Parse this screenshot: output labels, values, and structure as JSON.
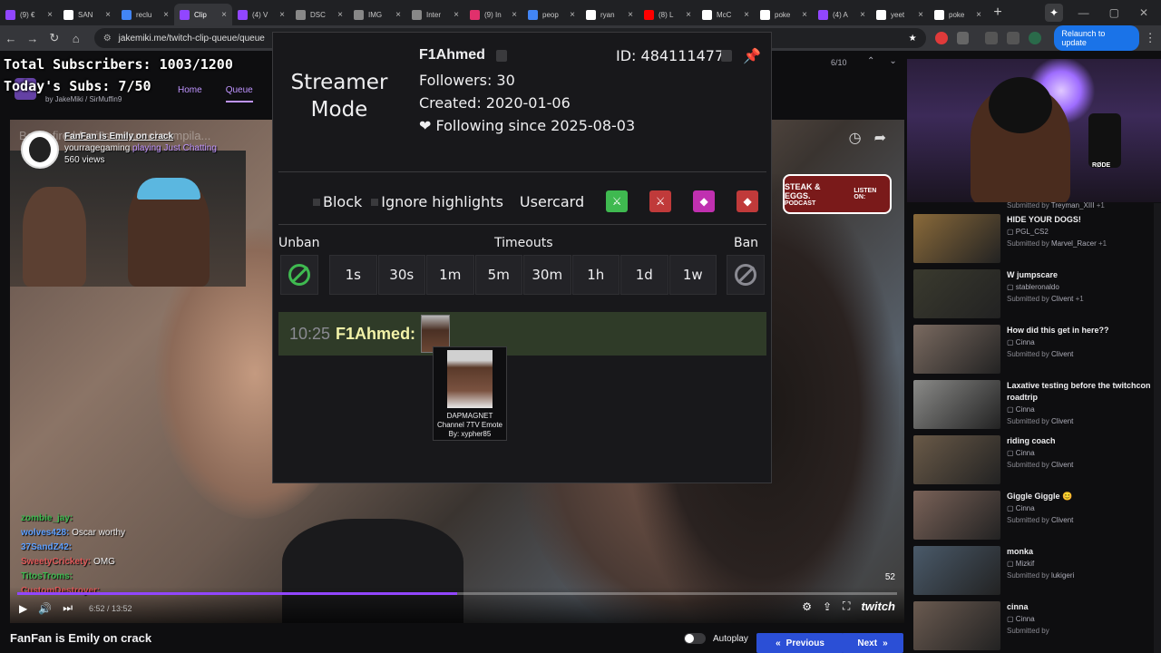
{
  "browser": {
    "tabs": [
      {
        "label": "(9) €",
        "color": "#9146ff"
      },
      {
        "label": "SAN",
        "color": "#fff"
      },
      {
        "label": "reclu",
        "color": "#4285f4"
      },
      {
        "label": "Clip",
        "color": "#9146ff",
        "active": true
      },
      {
        "label": "(4) V",
        "color": "#9146ff"
      },
      {
        "label": "DSC",
        "color": "#888"
      },
      {
        "label": "IMG",
        "color": "#888"
      },
      {
        "label": "Inter",
        "color": "#888"
      },
      {
        "label": "(9) In",
        "color": "#e1306c"
      },
      {
        "label": "peop",
        "color": "#4285f4"
      },
      {
        "label": "ryan",
        "color": "#fff"
      },
      {
        "label": "(8) L",
        "color": "#ff0000"
      },
      {
        "label": "McC",
        "color": "#fff"
      },
      {
        "label": "poke",
        "color": "#fff"
      },
      {
        "label": "(4) A",
        "color": "#9146ff"
      },
      {
        "label": "yeet",
        "color": "#fff"
      },
      {
        "label": "poke",
        "color": "#fff"
      }
    ],
    "url": "jakemiki.me/twitch-clip-queue/queue",
    "relaunch_label": "Relaunch to update"
  },
  "overlay": {
    "total_subs": "Total Subscribers: 1003/1200",
    "today_subs": "Today's Subs: 7/50"
  },
  "site": {
    "credit": "by JakeMiki / SirMuffin9",
    "nav": [
      "Home",
      "Queue"
    ],
    "queue_position": "6/10"
  },
  "video": {
    "clip_title_overlay": "FanFan is Emily on crack",
    "bg_title": "Being fired for it's a cancel compila...",
    "channel": "yourragegaming",
    "game": "playing Just Chatting",
    "views": "560 views",
    "badge_title": "STEAK & EGGS.",
    "badge_sub": "PODCAST",
    "badge_listen": "LISTEN ON:",
    "viewers_count": "52",
    "time": "6:52 / 13:52",
    "progress": 0.5,
    "brand": "twitch",
    "chat": [
      {
        "user": "zombie_jay:",
        "msg": "",
        "cls": "grn"
      },
      {
        "user": "wolves428:",
        "msg": "Oscar worthy",
        "cls": ""
      },
      {
        "user": "37SandZ42:",
        "msg": "",
        "cls": ""
      },
      {
        "user": "SweetyCrickety:",
        "msg": "OMG",
        "cls": "red"
      },
      {
        "user": "TitosTroms:",
        "msg": "",
        "cls": "grn"
      },
      {
        "user": "CustomDestroyer:",
        "msg": "",
        "cls": "red"
      }
    ]
  },
  "below": {
    "title": "FanFan is Emily on crack",
    "autoplay_label": "Autoplay",
    "prev_label": "Previous",
    "next_label": "Next"
  },
  "queue": [
    {
      "title": "HIDE YOUR DOGS!",
      "creator": "PGL_CS2",
      "submitted": "Submitted by",
      "by": "Marvel_Racer",
      "plus": "+1",
      "color": "#8a6a3a"
    },
    {
      "title": "W jumpscare",
      "creator": "stableronaldo",
      "submitted": "Submitted by",
      "by": "Clivent",
      "plus": "+1",
      "color": "#3a3a2e"
    },
    {
      "title": "How did this get in here??",
      "creator": "Cinna",
      "submitted": "Submitted by",
      "by": "Clivent",
      "plus": "",
      "color": "#7a6a60"
    },
    {
      "title": "Laxative testing before the twitchcon roadtrip",
      "creator": "Cinna",
      "submitted": "Submitted by",
      "by": "Clivent",
      "plus": "",
      "color": "#8a8a88"
    },
    {
      "title": "riding coach",
      "creator": "Cinna",
      "submitted": "Submitted by",
      "by": "Clivent",
      "plus": "",
      "color": "#6a5a48"
    },
    {
      "title": "Giggle Giggle 😊",
      "creator": "Cinna",
      "submitted": "Submitted by",
      "by": "Clivent",
      "plus": "",
      "color": "#7a6258"
    },
    {
      "title": "monka",
      "creator": "Mizkif",
      "submitted": "Submitted by",
      "by": "lukigeri",
      "plus": "",
      "color": "#4a5a6a"
    },
    {
      "title": "cinna",
      "creator": "Cinna",
      "submitted": "Submitted by",
      "by": "",
      "plus": "",
      "color": "#6a5a50"
    }
  ],
  "queue_top": {
    "submitted": "Submitted by",
    "by": "Treyman_XIII",
    "plus": "+1"
  },
  "modal": {
    "streamer_mode": "Streamer Mode",
    "username": "F1Ahmed",
    "followers": "Followers: 30",
    "created": "Created: 2020-01-06",
    "following": "❤ Following since 2025-08-03",
    "id": "ID: 484111477",
    "block_label": "Block",
    "ignore_label": "Ignore highlights",
    "usercard_label": "Usercard",
    "unban_label": "Unban",
    "timeouts_label": "Timeouts",
    "ban_label": "Ban",
    "timeouts": [
      "1s",
      "30s",
      "1m",
      "5m",
      "30m",
      "1h",
      "1d",
      "1w"
    ],
    "badge_colors": [
      "#3fb950",
      "#c03a3a",
      "#c030b0",
      "#c03a3a"
    ],
    "chat_time": "10:25",
    "chat_user": "F1Ahmed:",
    "emote_name": "DAPMAGNET",
    "emote_type": "Channel 7TV Emote",
    "emote_by": "By: xypher85"
  }
}
